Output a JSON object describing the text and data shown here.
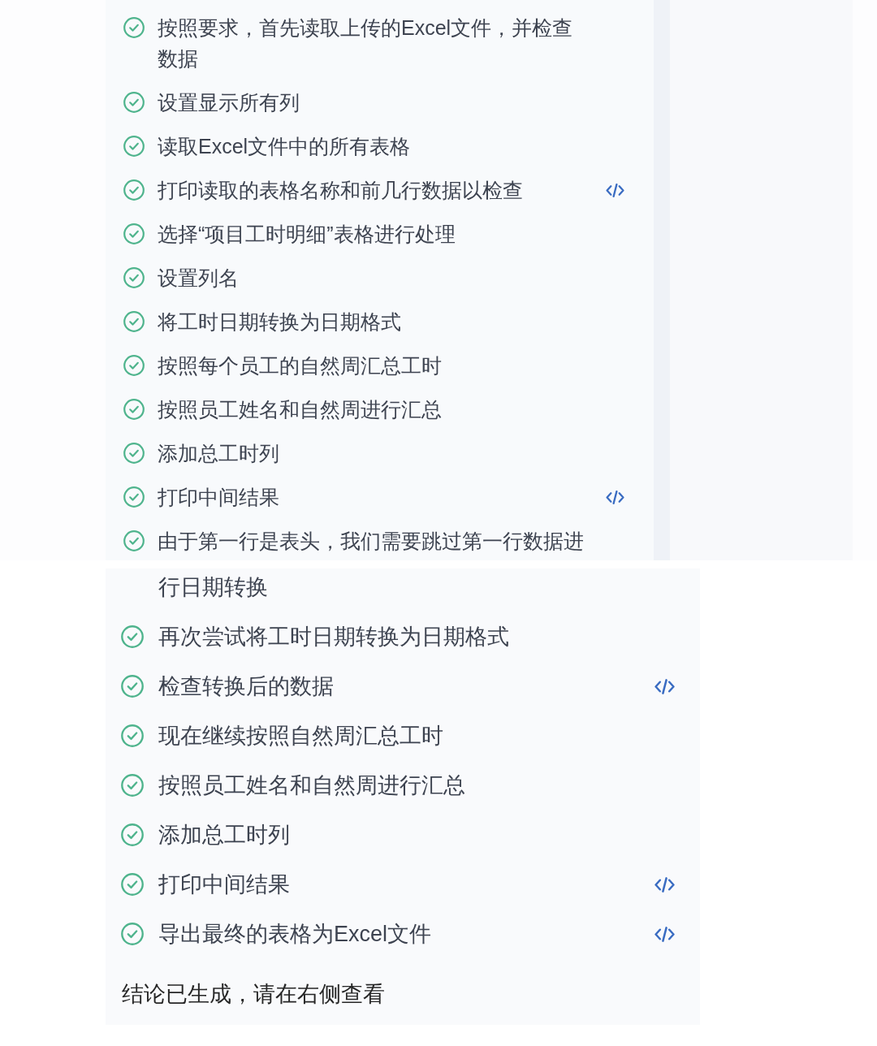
{
  "top_panel": {
    "steps": [
      {
        "text": "按照要求，首先读取上传的Excel文件，并检查数据",
        "done": true,
        "code": false
      },
      {
        "text": "设置显示所有列",
        "done": true,
        "code": false
      },
      {
        "text": "读取Excel文件中的所有表格",
        "done": true,
        "code": false
      },
      {
        "text": "打印读取的表格名称和前几行数据以检查",
        "done": true,
        "code": true
      },
      {
        "text": "选择“项目工时明细”表格进行处理",
        "done": true,
        "code": false
      },
      {
        "text": "设置列名",
        "done": true,
        "code": false
      },
      {
        "text": "将工时日期转换为日期格式",
        "done": true,
        "code": false
      },
      {
        "text": "按照每个员工的自然周汇总工时",
        "done": true,
        "code": false
      },
      {
        "text": "按照员工姓名和自然周进行汇总",
        "done": true,
        "code": false
      },
      {
        "text": "添加总工时列",
        "done": true,
        "code": false
      },
      {
        "text": "打印中间结果",
        "done": true,
        "code": true
      },
      {
        "text": "由于第一行是表头，我们需要跳过第一行数据进",
        "done": true,
        "code": false
      }
    ]
  },
  "bottom_panel": {
    "continued_text": "行日期转换",
    "steps": [
      {
        "text": "再次尝试将工时日期转换为日期格式",
        "done": true,
        "code": false
      },
      {
        "text": "检查转换后的数据",
        "done": true,
        "code": true
      },
      {
        "text": "现在继续按照自然周汇总工时",
        "done": true,
        "code": false
      },
      {
        "text": "按照员工姓名和自然周进行汇总",
        "done": true,
        "code": false
      },
      {
        "text": "添加总工时列",
        "done": true,
        "code": false
      },
      {
        "text": "打印中间结果",
        "done": true,
        "code": true
      },
      {
        "text": "导出最终的表格为Excel文件",
        "done": true,
        "code": true
      }
    ],
    "conclusion": "结论已生成，请在右侧查看"
  }
}
